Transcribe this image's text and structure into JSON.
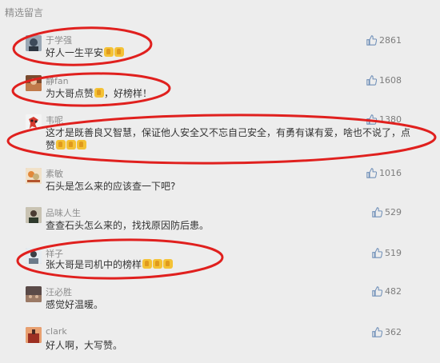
{
  "header": {
    "title": "精选留言"
  },
  "comments": [
    {
      "name": "于学强",
      "content": "好人一生平安",
      "emoji_count": 2,
      "likes": "2861",
      "avatar_color": "#6b7a8c"
    },
    {
      "name": "静fan",
      "content": "为大哥点赞",
      "content_tail": "，好榜样！",
      "emoji_count": 1,
      "likes": "1608",
      "avatar_color": "#8a5a3c"
    },
    {
      "name": "韦呢",
      "content": "这才是既善良又智慧，保证他人安全又不忘自己安全，有勇有谋有爱，啥也不说了，点",
      "content_line2": "赞",
      "emoji_count": 3,
      "likes": "1380",
      "avatar_color": "#c0392b"
    },
    {
      "name": "素敏",
      "content": "石头是怎么来的应该查一下吧?",
      "emoji_count": 0,
      "likes": "1016",
      "avatar_color": "#d98c4a"
    },
    {
      "name": "品味人生",
      "content": "查查石头怎么来的，找找原因防后患。",
      "emoji_count": 0,
      "likes": "529",
      "avatar_color": "#5d6d5a"
    },
    {
      "name": "祥子",
      "content": "张大哥是司机中的榜样",
      "emoji_count": 3,
      "likes": "519",
      "avatar_color": "#9aa4ad"
    },
    {
      "name": "汪必胜",
      "content": "感觉好温暖。",
      "emoji_count": 0,
      "likes": "482",
      "avatar_color": "#7b5b52"
    },
    {
      "name": "clark",
      "content": "好人啊，大写赞。",
      "emoji_count": 0,
      "likes": "362",
      "avatar_color": "#b8452f"
    }
  ],
  "colors": {
    "annotation": "#e0201e",
    "background": "#ededed",
    "text": "#333333",
    "meta": "#8c8c8c"
  },
  "icons": {
    "like": "thumbs-up-icon",
    "emoji": "thumbs-up-emoji-icon"
  }
}
